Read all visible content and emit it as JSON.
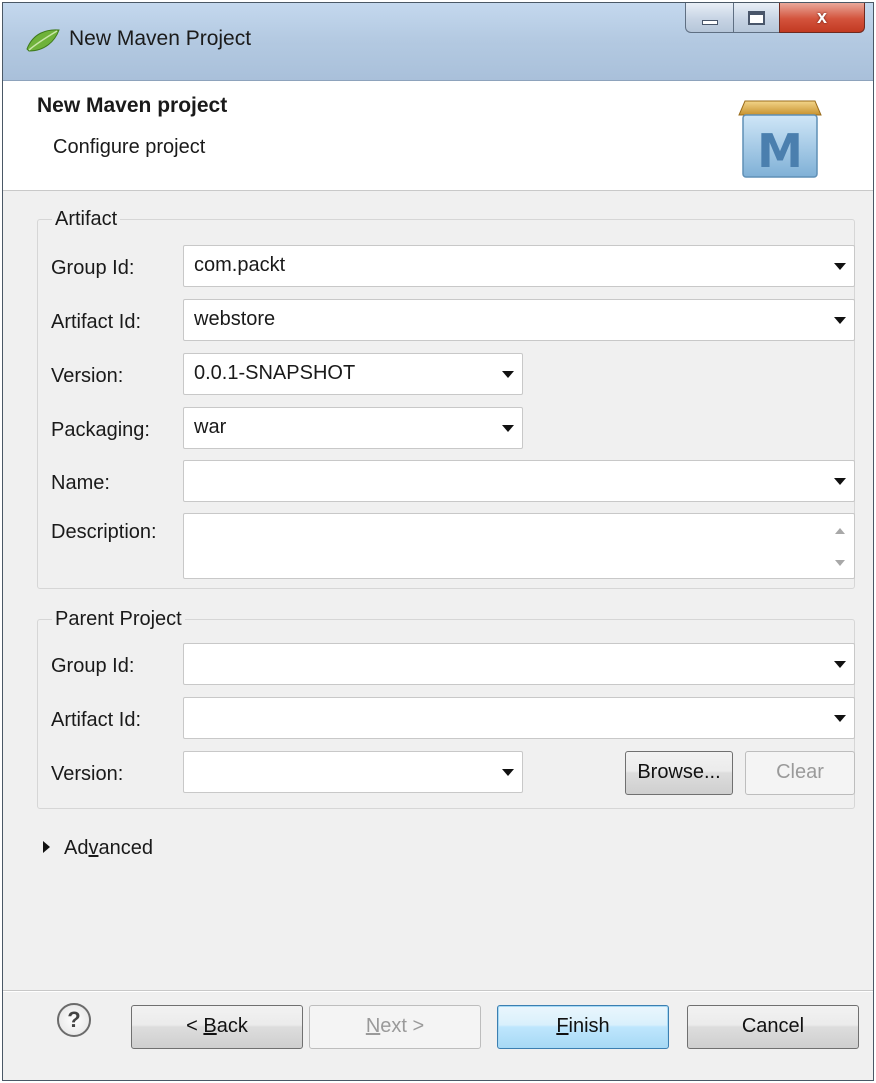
{
  "window": {
    "title": "New Maven Project",
    "close_glyph": "x"
  },
  "header": {
    "title": "New Maven project",
    "subtitle": "Configure project",
    "logo_letter": "M"
  },
  "artifact": {
    "group_label": "Artifact",
    "group_id": {
      "label": "Group Id:",
      "value": "com.packt"
    },
    "artifact_id": {
      "label": "Artifact Id:",
      "value": "webstore"
    },
    "version": {
      "label": "Version:",
      "value": "0.0.1-SNAPSHOT"
    },
    "packaging": {
      "label": "Packaging:",
      "value": "war"
    },
    "name": {
      "label": "Name:",
      "value": ""
    },
    "description": {
      "label": "Description:",
      "value": ""
    }
  },
  "parent": {
    "group_label": "Parent Project",
    "group_id": {
      "label": "Group Id:",
      "value": ""
    },
    "artifact_id": {
      "label": "Artifact Id:",
      "value": ""
    },
    "version": {
      "label": "Version:",
      "value": ""
    },
    "browse_label": "Browse...",
    "clear_label": "Clear"
  },
  "advanced": {
    "label_pre": "Ad",
    "label_mnemonic": "v",
    "label_post": "anced"
  },
  "footer": {
    "help_glyph": "?",
    "back_pre": "< ",
    "back_mnemonic": "B",
    "back_post": "ack",
    "next_mnemonic": "N",
    "next_post": "ext >",
    "finish_mnemonic": "F",
    "finish_post": "inish",
    "cancel_label": "Cancel"
  },
  "icons": {
    "app": "spring-leaf-icon",
    "logo": "maven-logo-icon",
    "dropdown": "chevron-down-icon",
    "expand": "triangle-right-icon",
    "help": "help-icon"
  },
  "colors": {
    "titlebar": "#b3c9e1",
    "close_button": "#d3533c",
    "default_button": "#bee6fd",
    "dialog_bg": "#f0f0f0"
  }
}
